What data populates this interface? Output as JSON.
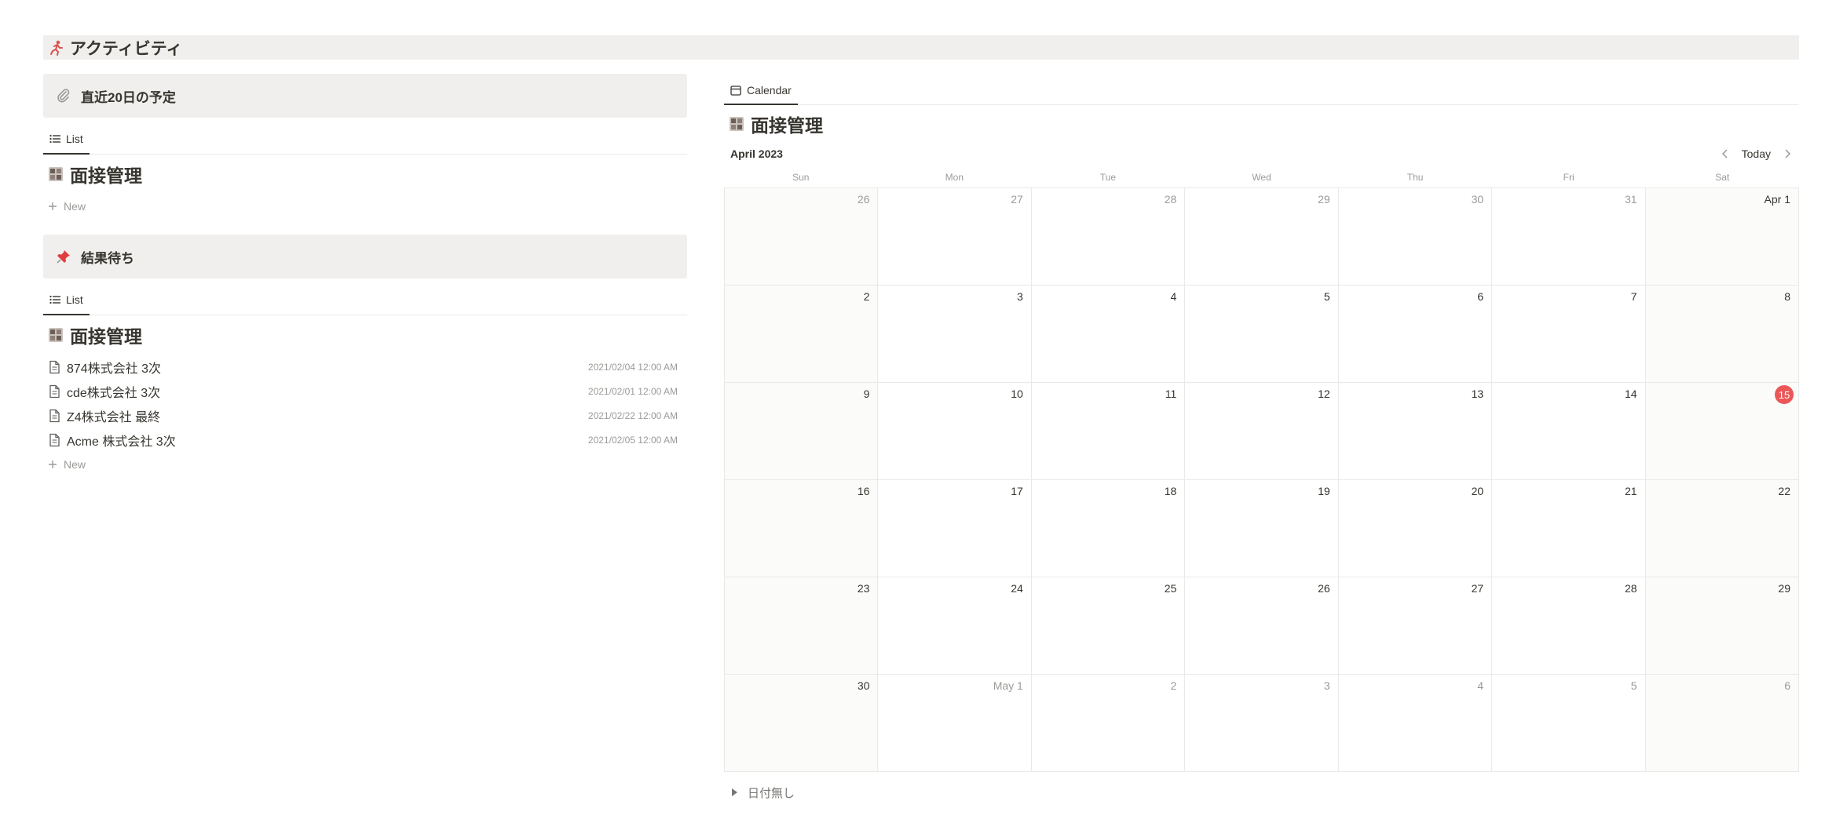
{
  "header": {
    "title": "アクティビティ",
    "icon": "runner-icon"
  },
  "sections": [
    {
      "callout_label": "直近20日の予定",
      "callout_icon": "paperclip-icon",
      "view_tab": "List",
      "db_title": "面接管理",
      "rows": [],
      "new_label": "New"
    },
    {
      "callout_label": "結果待ち",
      "callout_icon": "pushpin-icon",
      "view_tab": "List",
      "db_title": "面接管理",
      "rows": [
        {
          "title": "874株式会社 3次",
          "date": "2021/02/04 12:00 AM"
        },
        {
          "title": "cde株式会社 3次",
          "date": "2021/02/01 12:00 AM"
        },
        {
          "title": "Z4株式会社 最終",
          "date": "2021/02/22 12:00 AM"
        },
        {
          "title": "Acme 株式会社 3次",
          "date": "2021/02/05 12:00 AM"
        }
      ],
      "new_label": "New"
    }
  ],
  "calendar": {
    "view_tab": "Calendar",
    "db_title": "面接管理",
    "month_label": "April 2023",
    "today_label": "Today",
    "weekdays": [
      "Sun",
      "Mon",
      "Tue",
      "Wed",
      "Thu",
      "Fri",
      "Sat"
    ],
    "days": [
      [
        "26",
        "27",
        "28",
        "29",
        "30",
        "31",
        "Apr 1"
      ],
      [
        "2",
        "3",
        "4",
        "5",
        "6",
        "7",
        "8"
      ],
      [
        "9",
        "10",
        "11",
        "12",
        "13",
        "14",
        "15"
      ],
      [
        "16",
        "17",
        "18",
        "19",
        "20",
        "21",
        "22"
      ],
      [
        "23",
        "24",
        "25",
        "26",
        "27",
        "28",
        "29"
      ],
      [
        "30",
        "May 1",
        "2",
        "3",
        "4",
        "5",
        "6"
      ]
    ],
    "muted_first_row_upto": 6,
    "muted_last_row_from": 1,
    "today_day": "15",
    "today_color": "#eb5757",
    "no_date_label": "日付無し"
  }
}
